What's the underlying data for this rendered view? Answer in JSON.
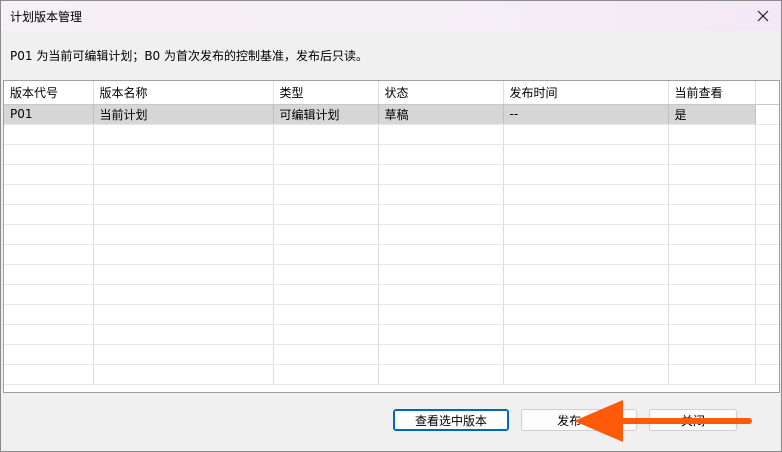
{
  "window": {
    "title": "计划版本管理",
    "info_text": "P01 为当前可编辑计划；B0 为首次发布的控制基准，发布后只读。"
  },
  "grid": {
    "columns": [
      "版本代号",
      "版本名称",
      "类型",
      "状态",
      "发布时间",
      "当前查看"
    ],
    "rows": [
      [
        "P01",
        "当前计划",
        "可编辑计划",
        "草稿",
        "--",
        "是"
      ]
    ]
  },
  "buttons": {
    "view_selected": "查看选中版本",
    "publish": "发布 B0",
    "close": "关闭"
  },
  "colors": {
    "selected_row": "#d6d6d6",
    "primary_border": "#0067c0",
    "annotation_arrow": "#ff5a0a"
  },
  "icons": {
    "close": "close-icon",
    "arrow": "annotation-arrow-icon"
  }
}
